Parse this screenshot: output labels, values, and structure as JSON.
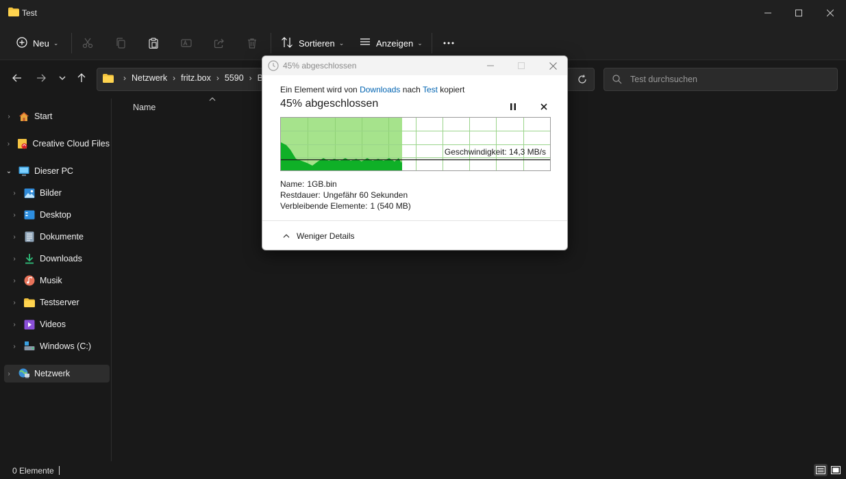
{
  "window": {
    "title": "Test"
  },
  "toolbar": {
    "new_label": "Neu",
    "sort_label": "Sortieren",
    "view_label": "Anzeigen"
  },
  "address": {
    "crumbs": [
      "Netzwerk",
      "fritz.box",
      "5590",
      "BA"
    ]
  },
  "search": {
    "placeholder": "Test durchsuchen"
  },
  "sidebar": {
    "items": [
      {
        "label": "Start",
        "icon": "home-icon"
      },
      {
        "label": "Creative Cloud Files",
        "icon": "creative-cloud-icon"
      },
      {
        "label": "Dieser PC",
        "icon": "pc-icon"
      },
      {
        "label": "Bilder",
        "icon": "pictures-icon"
      },
      {
        "label": "Desktop",
        "icon": "desktop-icon"
      },
      {
        "label": "Dokumente",
        "icon": "documents-icon"
      },
      {
        "label": "Downloads",
        "icon": "downloads-icon"
      },
      {
        "label": "Musik",
        "icon": "music-icon"
      },
      {
        "label": "Testserver",
        "icon": "folder-icon"
      },
      {
        "label": "Videos",
        "icon": "videos-icon"
      },
      {
        "label": "Windows (C:)",
        "icon": "drive-icon"
      },
      {
        "label": "Netzwerk",
        "icon": "network-icon"
      }
    ]
  },
  "content": {
    "column_name": "Name"
  },
  "status": {
    "count": "0 Elemente"
  },
  "dialog": {
    "title": "45% abgeschlossen",
    "desc_prefix": "Ein Element wird von",
    "source": "Downloads",
    "desc_mid": "nach",
    "destination": "Test",
    "desc_suffix": "kopiert",
    "heading": "45% abgeschlossen",
    "progress": 0.45,
    "speed_label": "Geschwindigkeit: 14,3 MB/s",
    "name_label": "Name:",
    "name_value": "1GB.bin",
    "remaining_label": "Restdauer:",
    "remaining_value": "Ungefähr 60 Sekunden",
    "items_label": "Verbleibende Elemente:",
    "items_value": "1 (540 MB)",
    "details_label": "Weniger Details"
  },
  "colors": {
    "graph_fill": "#a6e38c",
    "graph_area": "#0fb027",
    "link": "#0063b1"
  }
}
